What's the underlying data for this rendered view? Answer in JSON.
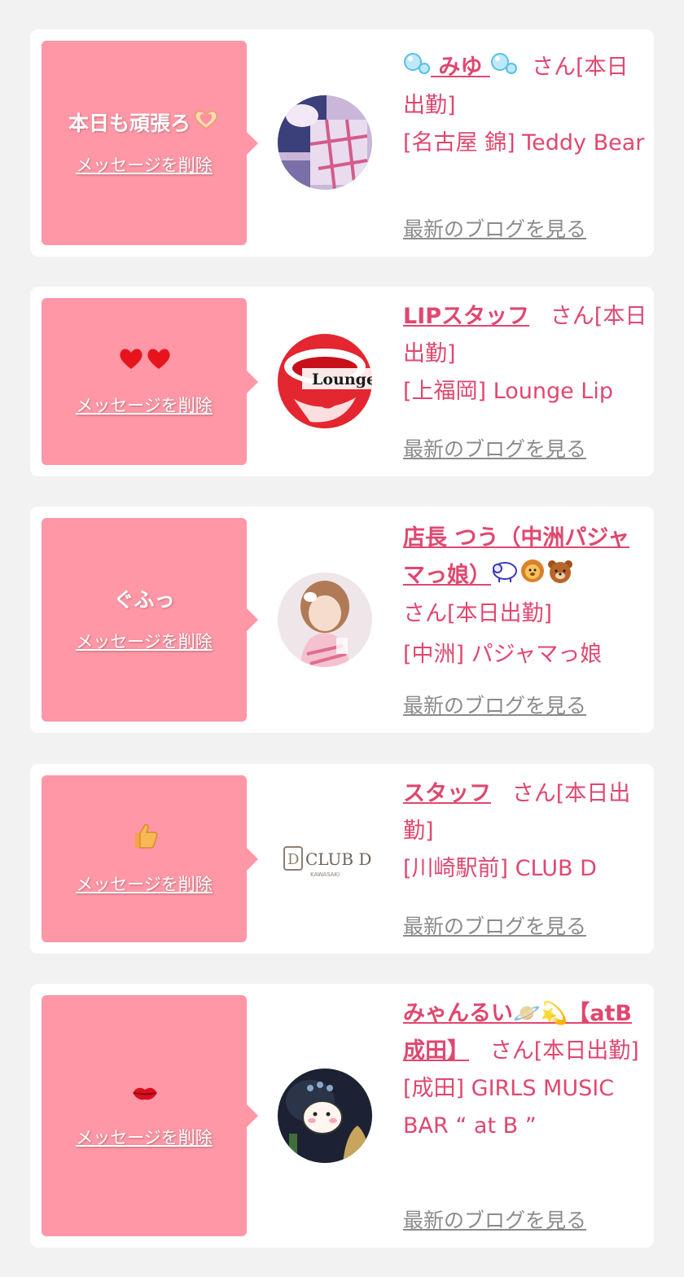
{
  "common": {
    "delete_label": "メッセージを削除",
    "blog_label": "最新のブログを見る",
    "accent_color": "#e0476f",
    "bubble_color": "#ff97a6"
  },
  "entries": [
    {
      "message": "本日も頑張ろ",
      "message_icon": "heart-hands-icon",
      "name": "みゆ",
      "name_icons": [
        "bubbles-icon",
        "bubbles-icon"
      ],
      "status": "さん[本日出勤]",
      "shop": "[名古屋 錦] Teddy Bear"
    },
    {
      "message": "",
      "message_icon": "two-red-hearts-icon",
      "name": "LIPスタッフ",
      "status": "さん[本日出勤]",
      "shop": "[上福岡] Lounge Lip",
      "avatar_logo_text": "Lounge"
    },
    {
      "message": "ぐふっ",
      "name": "店長 つう（中洲パジャマっ娘）",
      "name_icons": [
        "sheep-icon",
        "lion-icon",
        "bear-icon"
      ],
      "status": "さん[本日出勤]",
      "shop": "[中洲] パジャマっ娘"
    },
    {
      "message": "",
      "message_icon": "thumbs-up-icon",
      "name": "スタッフ",
      "status": "さん[本日出勤]",
      "shop": "[川崎駅前] CLUB D",
      "avatar_logo_text": "CLUB D",
      "avatar_logo_sub": "KAWASAKI"
    },
    {
      "message": "",
      "message_icon": "kiss-mark-icon",
      "name": "みゃんるい🪐💫【atB 成田】",
      "status": "さん[本日出勤]",
      "shop": "[成田] GIRLS MUSIC BAR “ at B ”"
    }
  ]
}
